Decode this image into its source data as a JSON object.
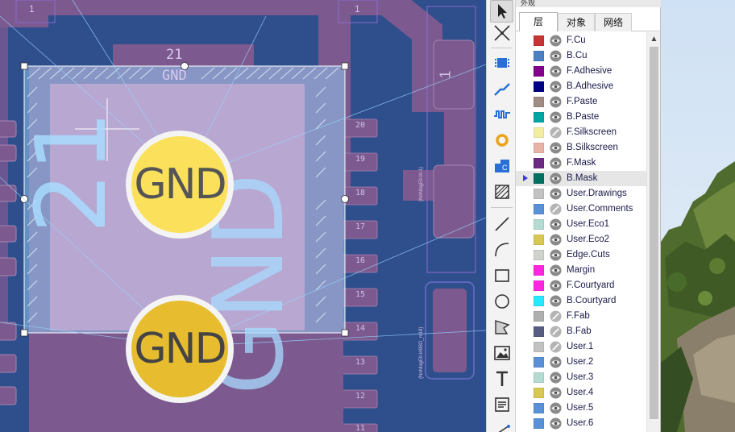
{
  "panel": {
    "title": "外观",
    "tabs": [
      "层",
      "对象",
      "网络"
    ],
    "active_tab": 0
  },
  "layers": [
    {
      "name": "F.Cu",
      "color": "#c83434",
      "visible": true
    },
    {
      "name": "B.Cu",
      "color": "#4d7fc4",
      "visible": true
    },
    {
      "name": "F.Adhesive",
      "color": "#84008c",
      "visible": true
    },
    {
      "name": "B.Adhesive",
      "color": "#000085",
      "visible": true
    },
    {
      "name": "F.Paste",
      "color": "#a08b85",
      "visible": true
    },
    {
      "name": "B.Paste",
      "color": "#00a6a4",
      "visible": true
    },
    {
      "name": "F.Silkscreen",
      "color": "#f2eda1",
      "visible": false
    },
    {
      "name": "B.Silkscreen",
      "color": "#e8b2a7",
      "visible": true
    },
    {
      "name": "F.Mask",
      "color": "#6a2a82",
      "visible": true
    },
    {
      "name": "B.Mask",
      "color": "#02705f",
      "visible": true,
      "selected": true
    },
    {
      "name": "User.Drawings",
      "color": "#c2c2c2",
      "visible": true
    },
    {
      "name": "User.Comments",
      "color": "#5991d9",
      "visible": false
    },
    {
      "name": "User.Eco1",
      "color": "#b4dbd2",
      "visible": true
    },
    {
      "name": "User.Eco2",
      "color": "#d8c852",
      "visible": true
    },
    {
      "name": "Edge.Cuts",
      "color": "#d0d2cd",
      "visible": true
    },
    {
      "name": "Margin",
      "color": "#ff26e2",
      "visible": true
    },
    {
      "name": "F.Courtyard",
      "color": "#ff26e2",
      "visible": true
    },
    {
      "name": "B.Courtyard",
      "color": "#26e9ff",
      "visible": true
    },
    {
      "name": "F.Fab",
      "color": "#afafaf",
      "visible": false
    },
    {
      "name": "B.Fab",
      "color": "#585d84",
      "visible": false
    },
    {
      "name": "User.1",
      "color": "#c2c2c2",
      "visible": false
    },
    {
      "name": "User.2",
      "color": "#5991d9",
      "visible": true
    },
    {
      "name": "User.3",
      "color": "#b4dbd2",
      "visible": true
    },
    {
      "name": "User.4",
      "color": "#d8c852",
      "visible": true
    },
    {
      "name": "User.5",
      "color": "#5991d9",
      "visible": true
    },
    {
      "name": "User.6",
      "color": "#5991d9",
      "visible": true
    }
  ],
  "toolbar": {
    "tools": [
      "select-tool-icon",
      "local-ratsnest-icon",
      "add-footprint-icon",
      "route-track-icon",
      "tune-length-icon",
      "add-via-icon",
      "add-zone-icon",
      "add-rule-area-icon",
      "draw-line-icon",
      "draw-arc-icon",
      "draw-rectangle-icon",
      "draw-circle-icon",
      "draw-polygon-icon",
      "add-image-icon",
      "add-text-icon",
      "add-textbox-icon",
      "add-dimension-icon"
    ]
  },
  "canvas": {
    "pad_number": "21",
    "pad_net": "GND",
    "via_label_top": "GND",
    "via_label_bottom": "GND",
    "big_text_number": "21",
    "big_text_net": "GND",
    "top_markers": [
      "1",
      "1"
    ],
    "small_pad_numbers": [
      "20",
      "19",
      "18",
      "17",
      "16",
      "15",
      "14",
      "13",
      "12",
      "11"
    ],
    "side_pad_number": "1",
    "tiny_label": "{NoNlagEll-Irl-1}",
    "tiny_label_bottom": "{NoNlagEll-Irl9BD_m18}"
  },
  "colors": {
    "board": "#2d4a85",
    "copper_pad": "#7c5a8f",
    "selection_fill": "#7fb9e8",
    "via_fill": "#f0c330",
    "via_ring": "#f4f4f4"
  }
}
